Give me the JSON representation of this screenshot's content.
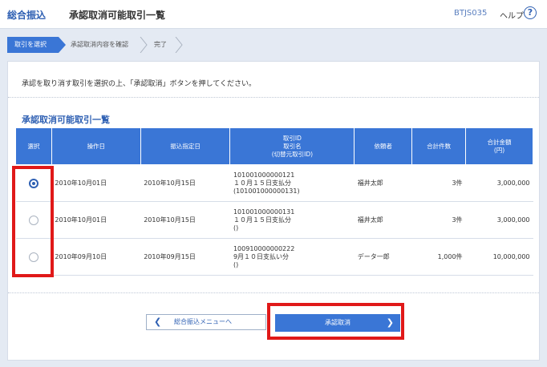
{
  "header": {
    "category": "総合振込",
    "title": "承認取消可能取引一覧",
    "screen_code": "BTJS035",
    "help_label": "ヘルプ",
    "help_icon_glyph": "?"
  },
  "steps": [
    {
      "label": "取引を選択",
      "active": true
    },
    {
      "label": "承認取消内容を確認",
      "active": false
    },
    {
      "label": "完了",
      "active": false
    }
  ],
  "instruction": "承認を取り消す取引を選択の上、「承認取消」ボタンを押してください。",
  "section_title": "承認取消可能取引一覧",
  "table": {
    "headers": {
      "select": "選択",
      "operation_date": "操作日",
      "transfer_date": "振込指定日",
      "txn_id": "取引ID",
      "txn_name": "取引名",
      "source_txn_id": "(切替元取引ID)",
      "requester": "依頼者",
      "total_count": "合計件数",
      "total_amount": "合計金額",
      "total_amount_unit": "(円)"
    },
    "rows": [
      {
        "selected": true,
        "operation_date": "2010年10月01日",
        "transfer_date": "2010年10月15日",
        "txn_id": "101001000000121",
        "txn_name": "１０月１５日支払分",
        "source_txn_id": "(101001000000131)",
        "requester": "福井太郎",
        "total_count": "3件",
        "total_amount": "3,000,000"
      },
      {
        "selected": false,
        "operation_date": "2010年10月01日",
        "transfer_date": "2010年10月15日",
        "txn_id": "101001000000131",
        "txn_name": "１０月１５日支払分",
        "source_txn_id": "()",
        "requester": "福井太郎",
        "total_count": "3件",
        "total_amount": "3,000,000"
      },
      {
        "selected": false,
        "operation_date": "2010年09月10日",
        "transfer_date": "2010年09月15日",
        "txn_id": "100910000000222",
        "txn_name": "9月１０日支払い分",
        "source_txn_id": "()",
        "requester": "データ一郎",
        "total_count": "1,000件",
        "total_amount": "10,000,000"
      }
    ]
  },
  "buttons": {
    "back_label": "総合振込メニューへ",
    "back_icon_glyph": "❮",
    "cancel_approval_label": "承認取消",
    "cancel_approval_icon_glyph": "❯"
  },
  "colors": {
    "accent": "#3a76d6",
    "title_blue": "#2f60b3",
    "annotation_red": "#e01919",
    "background": "#e4eaf3"
  }
}
